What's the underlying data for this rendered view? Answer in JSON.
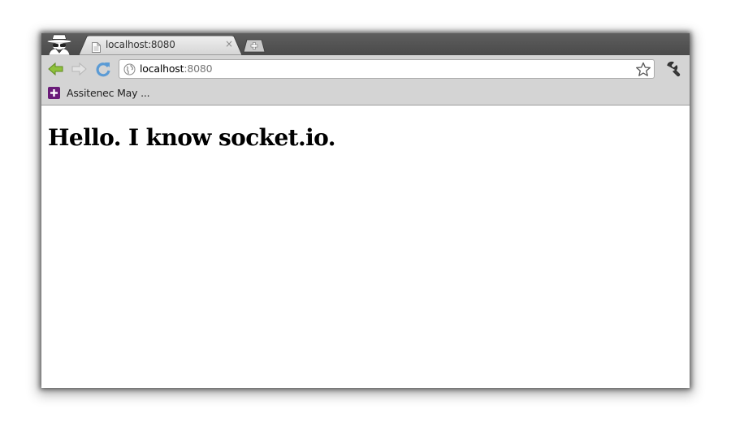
{
  "tab": {
    "title": "localhost:8080",
    "close_glyph": "×",
    "favicon": "page-icon"
  },
  "toolbar": {
    "back_icon": "back-arrow-icon",
    "forward_icon": "forward-arrow-icon",
    "reload_icon": "reload-icon",
    "menu_icon": "wrench-icon",
    "back_color": "#8fc13c",
    "reload_color": "#5b9bd5"
  },
  "omnibox": {
    "host": "localhost",
    "rest": ":8080",
    "site_icon": "globe-icon",
    "bookmark_icon": "star-icon"
  },
  "bookmarks": [
    {
      "label": "Assitenec May ...",
      "icon": "plus-icon",
      "icon_color": "#6a1b78"
    }
  ],
  "page": {
    "heading": "Hello. I know socket.io."
  }
}
